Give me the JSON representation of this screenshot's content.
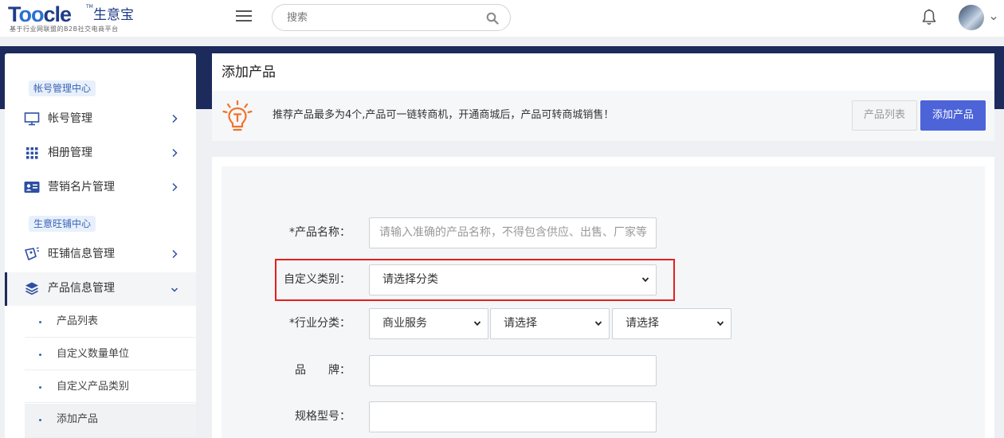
{
  "header": {
    "logo_word_a": "T",
    "logo_word_oo": "oo",
    "logo_word_b": "cle",
    "logo_tm": "TM",
    "logo_cn": "生意宝",
    "logo_tagline": "基于行业网联盟的B2B社交电商平台",
    "search_placeholder": "搜索"
  },
  "sidebar": {
    "section1": "帐号管理中心",
    "section2": "生意旺铺中心",
    "items": [
      {
        "label": "帐号管理"
      },
      {
        "label": "相册管理"
      },
      {
        "label": "营销名片管理"
      },
      {
        "label": "旺铺信息管理"
      },
      {
        "label": "产品信息管理"
      }
    ],
    "subitems": [
      {
        "label": "产品列表"
      },
      {
        "label": "自定义数量单位"
      },
      {
        "label": "自定义产品类别"
      },
      {
        "label": "添加产品"
      }
    ]
  },
  "main": {
    "title": "添加产品",
    "tip": "推荐产品最多为4个,产品可一链转商机，开通商城后，产品可转商城销售！",
    "btn_list": "产品列表",
    "btn_add": "添加产品"
  },
  "form": {
    "name_label": "*产品名称：",
    "name_placeholder": "请输入准确的产品名称，不得包含供应、出售、厂家等",
    "category_label": "自定义类别：",
    "category_value": "请选择分类",
    "industry_label": "*行业分类：",
    "industry_values": [
      "商业服务",
      "请选择",
      "请选择"
    ],
    "brand_label": "品　　牌：",
    "brand_value": "",
    "model_label": "规格型号：",
    "model_value": ""
  },
  "colors": {
    "brand_navy": "#1c2a5c",
    "primary_button": "#4d63d8",
    "highlight_red": "#e3201c",
    "tip_icon_orange": "#f0732a"
  }
}
